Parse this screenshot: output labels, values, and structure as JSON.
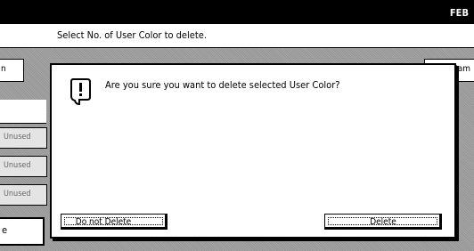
{
  "topbar": {
    "label": "FEB"
  },
  "instruction": "Select No. of User Color to delete.",
  "left_panel": {
    "tab_label": "n",
    "items": [
      "Unused",
      "Unused",
      "Unused"
    ],
    "bottom_label": "e"
  },
  "right_panel": {
    "tab_label": "Sam"
  },
  "dialog": {
    "message": "Are you sure you want to delete selected User Color?",
    "cancel_label": "Do not Delete",
    "confirm_label": "Delete"
  }
}
